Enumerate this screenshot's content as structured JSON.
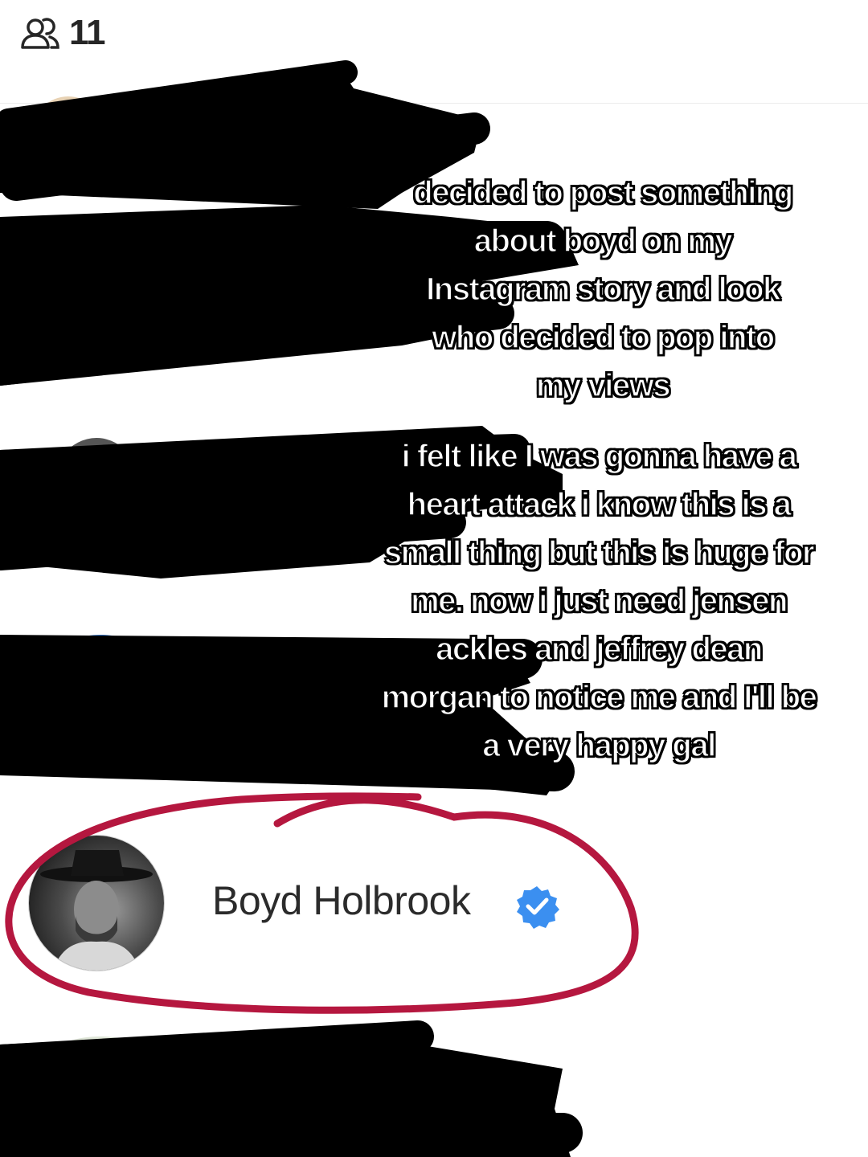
{
  "header": {
    "viewers_icon": "people-icon",
    "viewer_count": "11"
  },
  "caption": {
    "paragraph_1": [
      "decided to post something",
      "about boyd on my",
      "Instagram story and look",
      "who decided to pop into",
      "my views"
    ],
    "paragraph_2": [
      "i felt like I was gonna have a",
      "heart attack i know this is a",
      "small thing but this is huge for",
      "me. now i just need jensen",
      "ackles and jeffrey dean",
      "morgan to notice me and I'll be",
      "a  very happy gal"
    ]
  },
  "highlighted_viewer": {
    "name": "Boyd Holbrook",
    "verified_icon": "verified-badge-icon",
    "circle_color": "#b5173f"
  },
  "colors": {
    "redaction": "#000000",
    "verified": "#3b8ff0",
    "text": "#262626"
  }
}
